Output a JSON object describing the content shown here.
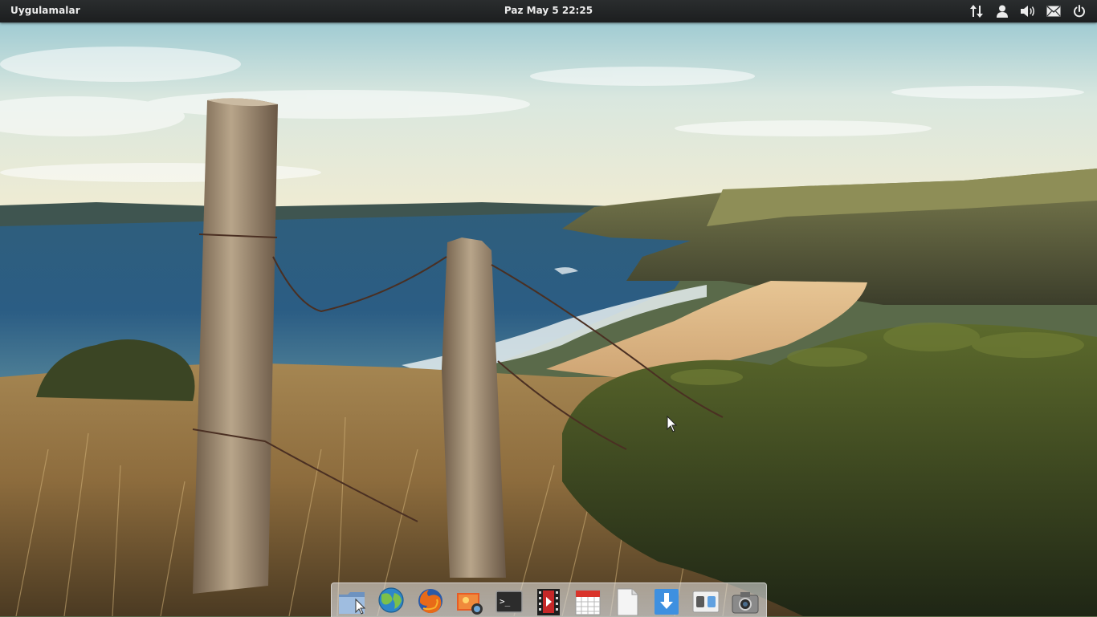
{
  "panel": {
    "applications_label": "Uygulamalar",
    "clock_text": "Paz May  5 22:25",
    "indicators": [
      {
        "name": "network-icon"
      },
      {
        "name": "user-icon"
      },
      {
        "name": "volume-icon"
      },
      {
        "name": "mail-icon"
      },
      {
        "name": "power-icon"
      }
    ]
  },
  "dock": {
    "items": [
      {
        "name": "dock-files-icon"
      },
      {
        "name": "dock-browser-icon"
      },
      {
        "name": "dock-firefox-icon"
      },
      {
        "name": "dock-shotwell-icon"
      },
      {
        "name": "dock-terminal-icon"
      },
      {
        "name": "dock-video-icon"
      },
      {
        "name": "dock-calendar-icon"
      },
      {
        "name": "dock-text-editor-icon"
      },
      {
        "name": "dock-software-center-icon"
      },
      {
        "name": "dock-settings-icon"
      },
      {
        "name": "dock-camera-icon"
      }
    ]
  },
  "colors": {
    "panel_bg": "#1f2122",
    "panel_text": "#ececec",
    "dock_bg": "#d8d8d8"
  }
}
